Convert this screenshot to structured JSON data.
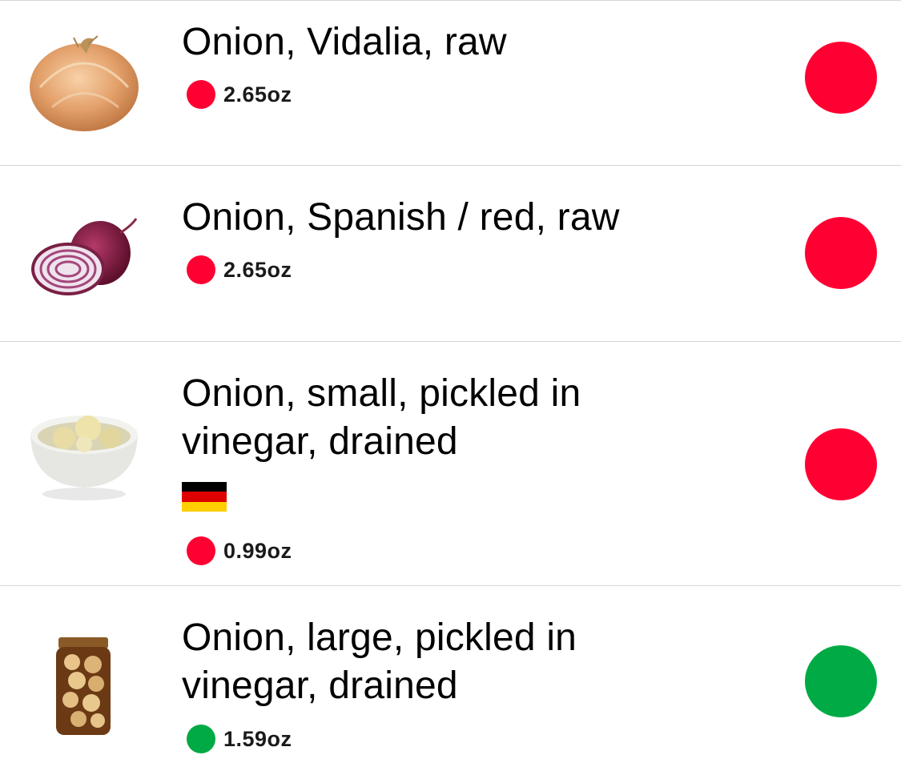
{
  "colors": {
    "red": "#ff0033",
    "green": "#00aa44",
    "divider": "#d6d6d6",
    "flag_black": "#000000",
    "flag_red": "#dd0000",
    "flag_gold": "#ffce00"
  },
  "items": [
    {
      "title": "Onion, Vidalia, raw",
      "quantity": "2.65oz",
      "status": "red",
      "image_icon": "yellow-onion-icon",
      "flag": null
    },
    {
      "title": "Onion, Spanish / red, raw",
      "quantity": "2.65oz",
      "status": "red",
      "image_icon": "red-onion-icon",
      "flag": null
    },
    {
      "title_line1": "Onion, small, pickled in",
      "title_line2": "vinegar, drained",
      "quantity": "0.99oz",
      "status": "red",
      "image_icon": "pickled-onion-bowl-icon",
      "flag": "germany-flag-icon"
    },
    {
      "title_line1": "Onion, large, pickled in",
      "title_line2": "vinegar, drained",
      "quantity": "1.59oz",
      "status": "green",
      "image_icon": "pickled-onion-jar-icon",
      "flag": null
    }
  ]
}
